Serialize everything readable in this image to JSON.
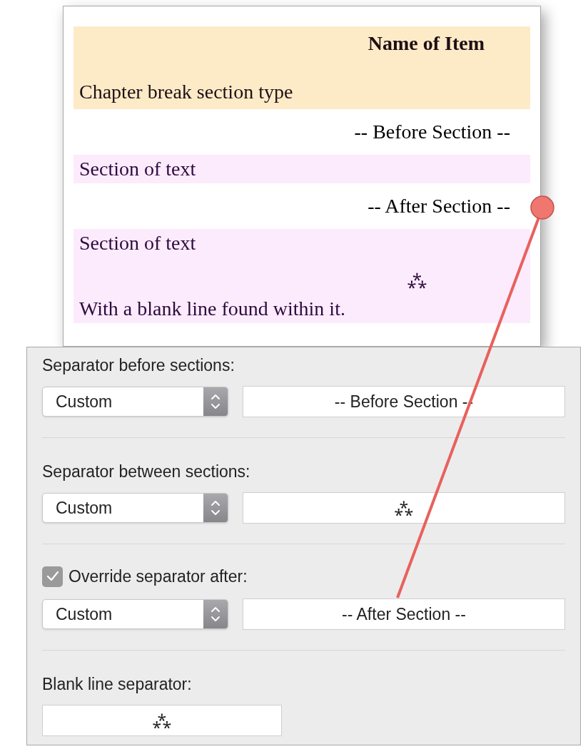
{
  "preview": {
    "blocks": [
      {
        "kind": "item",
        "title": "Name of Item",
        "subtitle": "Chapter break section type"
      },
      {
        "kind": "separator",
        "text": "-- Before Section --"
      },
      {
        "kind": "section",
        "lines": [
          {
            "kind": "text",
            "text": "Section of text"
          }
        ]
      },
      {
        "kind": "separator",
        "text": "-- After Section --"
      },
      {
        "kind": "section",
        "lines": [
          {
            "kind": "text",
            "text": "Section of text"
          },
          {
            "kind": "separator",
            "text": "⁂"
          },
          {
            "kind": "text",
            "text": "With a blank line found within it."
          }
        ]
      }
    ]
  },
  "settings": {
    "groups": [
      {
        "kind": "label",
        "label": "Separator before sections:",
        "select": "Custom",
        "field": "-- Before Section --"
      },
      {
        "kind": "label",
        "label": "Separator between sections:",
        "select": "Custom",
        "field": "⁂"
      },
      {
        "kind": "checkbox",
        "checked": true,
        "label": "Override separator after:",
        "select": "Custom",
        "field": "-- After Section --"
      },
      {
        "kind": "label",
        "label": "Blank line separator:",
        "field": "⁂"
      }
    ]
  }
}
